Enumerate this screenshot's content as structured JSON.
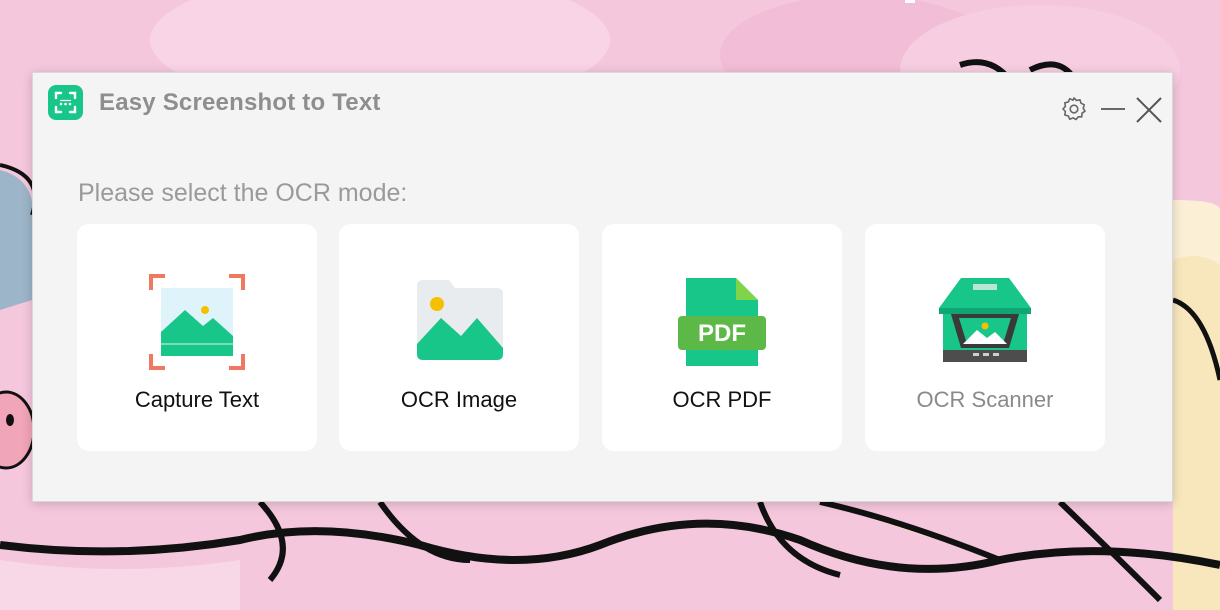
{
  "app": {
    "title": "Easy Screenshot to Text",
    "logo_icon": "scan-frame-icon",
    "accent_color": "#19c68a"
  },
  "title_bar": {
    "buttons": [
      {
        "icon": "gear-icon"
      },
      {
        "icon": "minimize-icon"
      },
      {
        "icon": "close-icon"
      }
    ]
  },
  "main": {
    "prompt": "Please select the OCR mode:",
    "modes": [
      {
        "label": "Capture Text",
        "icon": "capture-frame-icon",
        "enabled": true
      },
      {
        "label": "OCR Image",
        "icon": "image-icon",
        "enabled": true
      },
      {
        "label": "OCR PDF",
        "icon": "pdf-file-icon",
        "icon_text": "PDF",
        "enabled": true
      },
      {
        "label": "OCR Scanner",
        "icon": "scanner-icon",
        "enabled": false
      }
    ]
  },
  "colors": {
    "window_bg": "#f4f4f4",
    "card_bg": "#ffffff",
    "title_text": "#8e8e8e",
    "capture_frame": "#f07860",
    "image_sun": "#f5c000"
  }
}
